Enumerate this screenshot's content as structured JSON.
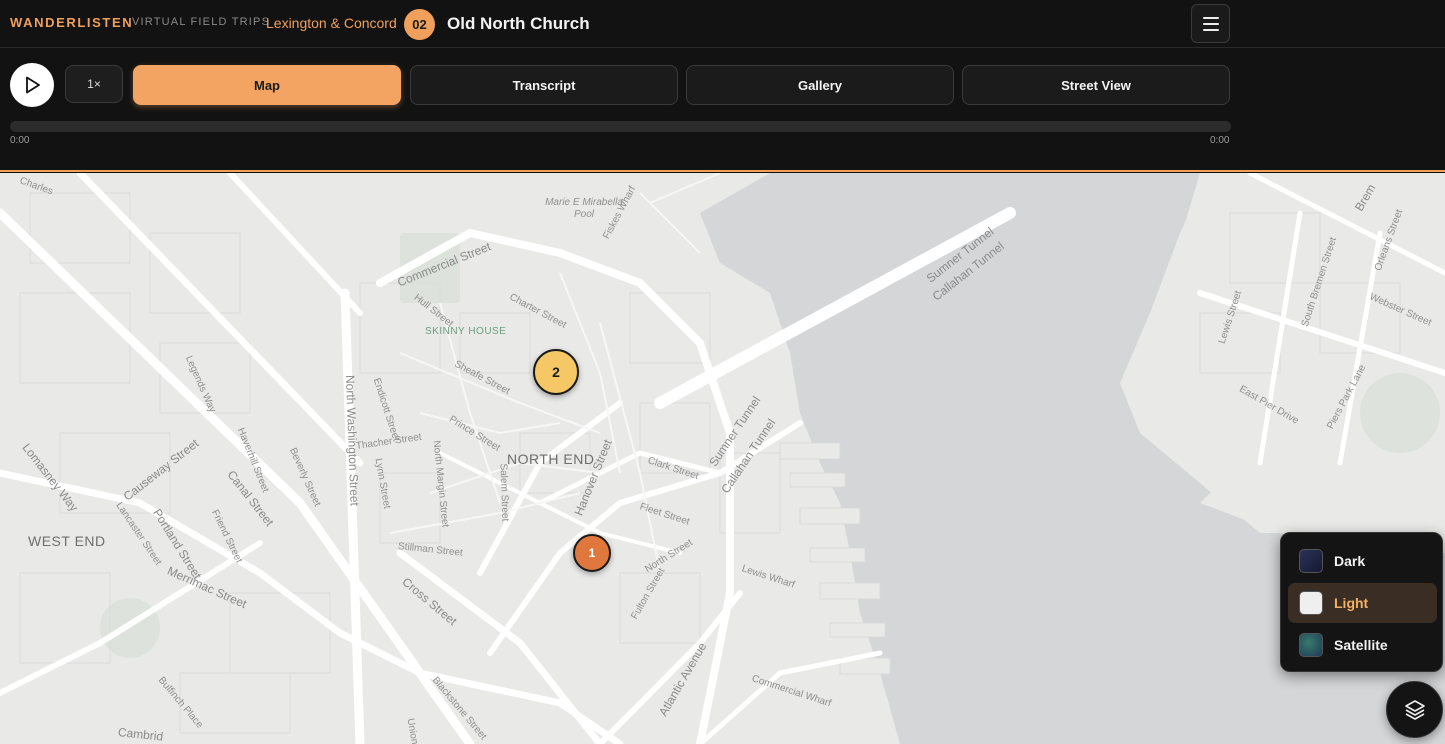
{
  "header": {
    "brand": "WANDERLISTEN",
    "subbrand": "VIRTUAL FIELD TRIPS",
    "tour_name": "Lexington & Concord",
    "stop_number": "02",
    "stop_title": "Old North Church"
  },
  "player": {
    "speed_label": "1×",
    "current_time": "0:00",
    "duration": "0:00",
    "progress_fraction": 0
  },
  "tabs": [
    {
      "label": "Map",
      "active": true
    },
    {
      "label": "Transcript",
      "active": false
    },
    {
      "label": "Gallery",
      "active": false
    },
    {
      "label": "Street View",
      "active": false
    }
  ],
  "map": {
    "labels": {
      "north_end": "NORTH END",
      "west_end": "WEST END",
      "skinny_house": "SKINNY HOUSE",
      "pool": "Marie E Mirabella Pool",
      "commercial_street": "Commercial Street",
      "charter_street": "Charter Street",
      "hull_street": "Hull Street",
      "sheafe_street": "Sheafe Street",
      "prince_street": "Prince Street",
      "north_washington": "North Washington Street",
      "endicott_street": "Endicott Street",
      "thacher_street": "Thacher Street",
      "north_margin": "North Margin Street",
      "salem_street": "Salem Street",
      "hanover_street": "Hanover Street",
      "clark_street": "Clark Street",
      "fleet_street": "Fleet Street",
      "north_street": "North Street",
      "fulton_street": "Fulton Street",
      "lewis_wharf": "Lewis Wharf",
      "commercial_wharf": "Commercial Wharf",
      "atlantic_avenue": "Atlantic Avenue",
      "cross_street": "Cross Street",
      "stillman_street": "Stillman Street",
      "causeway_street": "Causeway Street",
      "canal_street": "Canal Street",
      "portland_street": "Portland Street",
      "merrimac_street": "Merrimac Street",
      "lomasney_way": "Lomasney Way",
      "legends_way": "Legends Way",
      "haverhill_street": "Haverhill Street",
      "beverly_street": "Beverly Street",
      "friend_street": "Friend Street",
      "lancaster_street": "Lancaster Street",
      "lynn_street": "Lynn Street",
      "sumner_tunnel_1": "Sumner Tunnel",
      "callahan_tunnel_1": "Callahan Tunnel",
      "sumner_tunnel_2": "Sumner Tunnel",
      "callahan_tunnel_2": "Callahan Tunnel",
      "lewis_street": "Lewis Street",
      "south_bremen": "South Bremen Street",
      "webster_street": "Webster Street",
      "orleans_street": "Orleans Street",
      "east_pier_drive": "East Pier Drive",
      "piers_park_lane": "Piers Park Lane",
      "bremen": "Brem",
      "charles": "Charles",
      "blackstone_street": "Blackstone Street",
      "bulfinch_place": "Bulfinch Place",
      "union_street": "Union",
      "cambridge": "Cambrid",
      "fiskes_wharf": "Fiskes Wharf"
    },
    "markers": [
      {
        "label": "2",
        "color": "#f6c865"
      },
      {
        "label": "1",
        "color": "#e0783e"
      }
    ]
  },
  "layers": {
    "options": [
      {
        "label": "Dark",
        "selected": false,
        "swatch": "#1e2340"
      },
      {
        "label": "Light",
        "selected": true,
        "swatch": "#eeeeee"
      },
      {
        "label": "Satellite",
        "selected": false,
        "swatch": "#2f5a4a"
      }
    ]
  },
  "colors": {
    "accent": "#f0a05a",
    "background": "#121212",
    "map_land": "#e9e9e8",
    "map_water": "#d4d6d8"
  },
  "icons": {
    "play": "play-icon",
    "menu": "hamburger-menu-icon",
    "layers": "layers-stack-icon"
  }
}
